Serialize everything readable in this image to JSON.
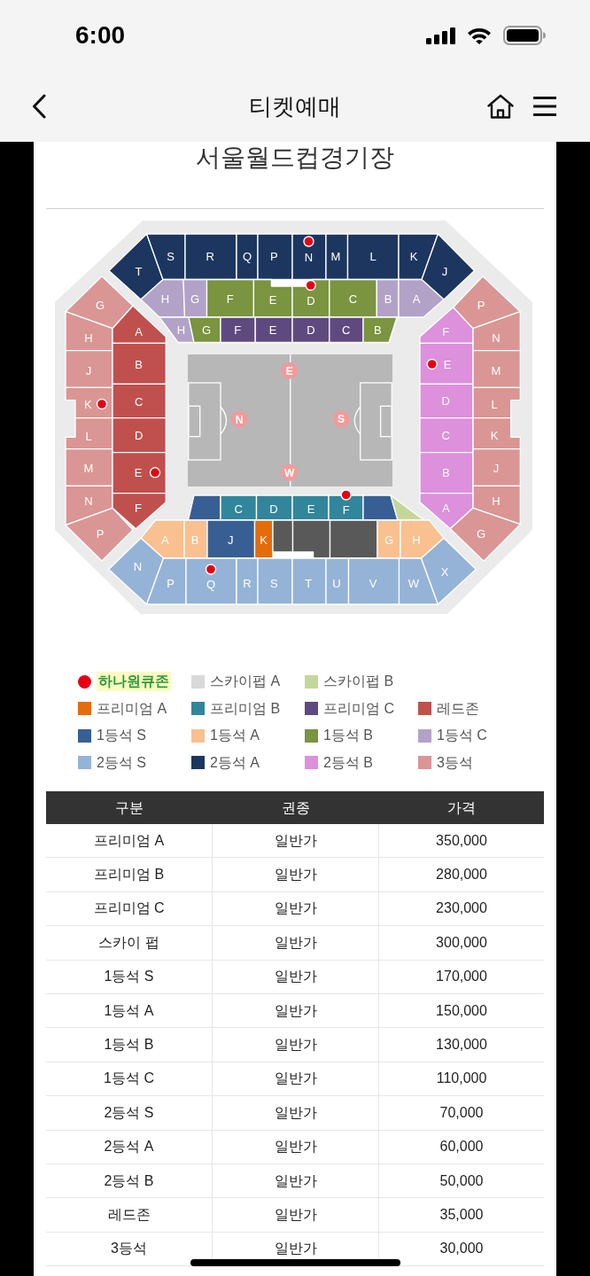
{
  "status_bar": {
    "time": "6:00"
  },
  "nav_bar": {
    "title": "티켓예매"
  },
  "venue_title": "서울월드컵경기장",
  "seat_map": {
    "sections": [
      {
        "label": "T",
        "color": "#1c3660",
        "hana_zone": false
      },
      {
        "label": "S",
        "color": "#1c3660",
        "hana_zone": false
      },
      {
        "label": "R",
        "color": "#1c3660",
        "hana_zone": false
      },
      {
        "label": "Q",
        "color": "#1c3660",
        "hana_zone": false
      },
      {
        "label": "P",
        "color": "#1c3660",
        "hana_zone": false
      },
      {
        "label": "N",
        "color": "#1c3660",
        "hana_zone": true
      },
      {
        "label": "M",
        "color": "#1c3660",
        "hana_zone": false
      },
      {
        "label": "L",
        "color": "#1c3660",
        "hana_zone": false
      },
      {
        "label": "K",
        "color": "#1c3660",
        "hana_zone": false
      },
      {
        "label": "J",
        "color": "#1c3660",
        "hana_zone": false
      },
      {
        "label": "H",
        "color": "#b3a2c8",
        "hana_zone": false
      },
      {
        "label": "G",
        "color": "#b3a2c8",
        "hana_zone": false
      },
      {
        "label": "F",
        "color": "#7a9440",
        "hana_zone": false
      },
      {
        "label": "E",
        "color": "#7a9440",
        "hana_zone": false
      },
      {
        "label": "D",
        "color": "#7a9440",
        "hana_zone": true
      },
      {
        "label": "C",
        "color": "#7a9440",
        "hana_zone": false
      },
      {
        "label": "B",
        "color": "#b3a2c8",
        "hana_zone": false
      },
      {
        "label": "A",
        "color": "#b3a2c8",
        "hana_zone": false
      },
      {
        "label": "H",
        "color": "#b3a2c8",
        "hana_zone": false
      },
      {
        "label": "G",
        "color": "#7a9440",
        "hana_zone": false
      },
      {
        "label": "F",
        "color": "#5f4a80",
        "hana_zone": false
      },
      {
        "label": "E",
        "color": "#5f4a80",
        "hana_zone": false
      },
      {
        "label": "D",
        "color": "#5f4a80",
        "hana_zone": false
      },
      {
        "label": "C",
        "color": "#5f4a80",
        "hana_zone": false
      },
      {
        "label": "B",
        "color": "#7a9440",
        "hana_zone": false
      },
      {
        "label": "G",
        "color": "#d99694",
        "hana_zone": false
      },
      {
        "label": "H",
        "color": "#d99694",
        "hana_zone": false
      },
      {
        "label": "J",
        "color": "#d99694",
        "hana_zone": false
      },
      {
        "label": "K",
        "color": "#d99694",
        "hana_zone": true
      },
      {
        "label": "L",
        "color": "#d99694",
        "hana_zone": false
      },
      {
        "label": "M",
        "color": "#d99694",
        "hana_zone": false
      },
      {
        "label": "N",
        "color": "#d99694",
        "hana_zone": false
      },
      {
        "label": "P",
        "color": "#d99694",
        "hana_zone": false
      },
      {
        "label": "A",
        "color": "#c0504d",
        "hana_zone": false
      },
      {
        "label": "B",
        "color": "#c0504d",
        "hana_zone": false
      },
      {
        "label": "C",
        "color": "#c0504d",
        "hana_zone": false
      },
      {
        "label": "D",
        "color": "#c0504d",
        "hana_zone": false
      },
      {
        "label": "E",
        "color": "#c0504d",
        "hana_zone": true
      },
      {
        "label": "F",
        "color": "#c0504d",
        "hana_zone": false
      },
      {
        "label": "F",
        "color": "#dd90dc",
        "hana_zone": false
      },
      {
        "label": "E",
        "color": "#dd90dc",
        "hana_zone": true
      },
      {
        "label": "D",
        "color": "#dd90dc",
        "hana_zone": false
      },
      {
        "label": "C",
        "color": "#dd90dc",
        "hana_zone": false
      },
      {
        "label": "B",
        "color": "#dd90dc",
        "hana_zone": false
      },
      {
        "label": "A",
        "color": "#dd90dc",
        "hana_zone": false
      },
      {
        "label": "P",
        "color": "#d99694",
        "hana_zone": false
      },
      {
        "label": "N",
        "color": "#d99694",
        "hana_zone": false
      },
      {
        "label": "M",
        "color": "#d99694",
        "hana_zone": false
      },
      {
        "label": "L",
        "color": "#d99694",
        "hana_zone": false
      },
      {
        "label": "K",
        "color": "#d99694",
        "hana_zone": false
      },
      {
        "label": "J",
        "color": "#d99694",
        "hana_zone": false
      },
      {
        "label": "H",
        "color": "#d99694",
        "hana_zone": false
      },
      {
        "label": "G",
        "color": "#d99694",
        "hana_zone": false
      },
      {
        "color": "#375f94",
        "hana_zone": false
      },
      {
        "label": "C",
        "color": "#31869b",
        "hana_zone": false
      },
      {
        "label": "D",
        "color": "#31869b",
        "hana_zone": false
      },
      {
        "label": "E",
        "color": "#31869b",
        "hana_zone": false
      },
      {
        "label": "F",
        "color": "#31869b",
        "hana_zone": true
      },
      {
        "color": "#375f94",
        "hana_zone": false
      },
      {
        "color": "#c4d79b",
        "hana_zone": false
      },
      {
        "label": "A",
        "color": "#f9c090",
        "hana_zone": false
      },
      {
        "label": "B",
        "color": "#f9c090",
        "hana_zone": false
      },
      {
        "label": "J",
        "color": "#375f94",
        "hana_zone": false
      },
      {
        "label": "K",
        "color": "#e46c0a",
        "hana_zone": false
      },
      {
        "color": "#595959",
        "hana_zone": false
      },
      {
        "color": "#595959",
        "hana_zone": false
      },
      {
        "color": "#595959",
        "hana_zone": false
      },
      {
        "label": "G",
        "color": "#f9c090",
        "hana_zone": false
      },
      {
        "label": "H",
        "color": "#f9c090",
        "hana_zone": false
      },
      {
        "label": "N",
        "color": "#95b3d7",
        "hana_zone": false
      },
      {
        "label": "P",
        "color": "#95b3d7",
        "hana_zone": false
      },
      {
        "label": "Q",
        "color": "#95b3d7",
        "hana_zone": true
      },
      {
        "label": "R",
        "color": "#95b3d7",
        "hana_zone": false
      },
      {
        "label": "S",
        "color": "#95b3d7",
        "hana_zone": false
      },
      {
        "label": "T",
        "color": "#95b3d7",
        "hana_zone": false
      },
      {
        "label": "U",
        "color": "#95b3d7",
        "hana_zone": false
      },
      {
        "label": "V",
        "color": "#95b3d7",
        "hana_zone": false
      },
      {
        "label": "W",
        "color": "#95b3d7",
        "hana_zone": false
      },
      {
        "label": "X",
        "color": "#95b3d7",
        "hana_zone": false
      }
    ],
    "direction_markers": [
      "E",
      "N",
      "S",
      "W"
    ]
  },
  "legend": {
    "rows": [
      [
        {
          "kind": "dot",
          "label": "하나원큐존",
          "color": "#e60012",
          "highlighted": true
        },
        {
          "kind": "swatch",
          "label": "스카이펍 A",
          "color": "#d9d9d9",
          "highlighted": false
        },
        {
          "kind": "swatch",
          "label": "스카이펍 B",
          "color": "#c4d79b",
          "highlighted": false
        }
      ],
      [
        {
          "kind": "swatch",
          "label": "프리미엄 A",
          "color": "#e46c0a",
          "highlighted": false
        },
        {
          "kind": "swatch",
          "label": "프리미엄 B",
          "color": "#31869b",
          "highlighted": false
        },
        {
          "kind": "swatch",
          "label": "프리미엄 C",
          "color": "#5f4a80",
          "highlighted": false
        },
        {
          "kind": "swatch",
          "label": "레드존",
          "color": "#c0504d",
          "highlighted": false
        }
      ],
      [
        {
          "kind": "swatch",
          "label": "1등석 S",
          "color": "#375f94",
          "highlighted": false
        },
        {
          "kind": "swatch",
          "label": "1등석 A",
          "color": "#f9c090",
          "highlighted": false
        },
        {
          "kind": "swatch",
          "label": "1등석 B",
          "color": "#7a9440",
          "highlighted": false
        },
        {
          "kind": "swatch",
          "label": "1등석 C",
          "color": "#b3a2c8",
          "highlighted": false
        }
      ],
      [
        {
          "kind": "swatch",
          "label": "2등석 S",
          "color": "#95b3d7",
          "highlighted": false
        },
        {
          "kind": "swatch",
          "label": "2등석 A",
          "color": "#1c3660",
          "highlighted": false
        },
        {
          "kind": "swatch",
          "label": "2등석 B",
          "color": "#dd90dc",
          "highlighted": false
        },
        {
          "kind": "swatch",
          "label": "3등석",
          "color": "#d99694",
          "highlighted": false
        }
      ]
    ]
  },
  "price_table": {
    "columns": [
      "구분",
      "권종",
      "가격"
    ],
    "rows": [
      {
        "grade": "프리미엄 A",
        "ticket_type": "일반가",
        "price": "350,000"
      },
      {
        "grade": "프리미엄 B",
        "ticket_type": "일반가",
        "price": "280,000"
      },
      {
        "grade": "프리미엄 C",
        "ticket_type": "일반가",
        "price": "230,000"
      },
      {
        "grade": "스카이 펍",
        "ticket_type": "일반가",
        "price": "300,000"
      },
      {
        "grade": "1등석 S",
        "ticket_type": "일반가",
        "price": "170,000"
      },
      {
        "grade": "1등석 A",
        "ticket_type": "일반가",
        "price": "150,000"
      },
      {
        "grade": "1등석 B",
        "ticket_type": "일반가",
        "price": "130,000"
      },
      {
        "grade": "1등석 C",
        "ticket_type": "일반가",
        "price": "110,000"
      },
      {
        "grade": "2등석 S",
        "ticket_type": "일반가",
        "price": "70,000"
      },
      {
        "grade": "2등석 A",
        "ticket_type": "일반가",
        "price": "60,000"
      },
      {
        "grade": "2등석 B",
        "ticket_type": "일반가",
        "price": "50,000"
      },
      {
        "grade": "레드존",
        "ticket_type": "일반가",
        "price": "35,000"
      },
      {
        "grade": "3등석",
        "ticket_type": "일반가",
        "price": "30,000"
      }
    ]
  }
}
